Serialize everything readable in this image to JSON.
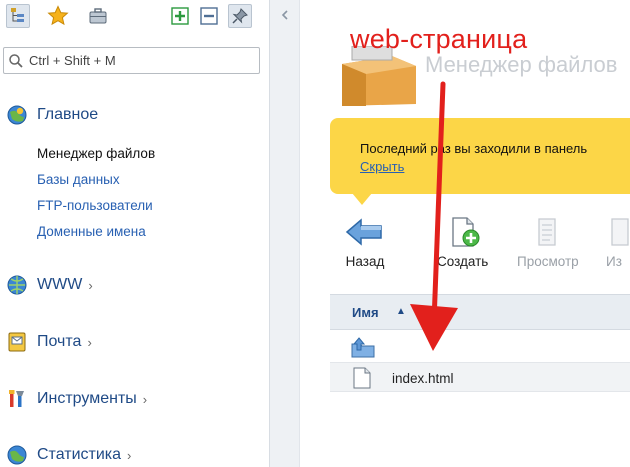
{
  "search": {
    "placeholder": "Ctrl + Shift + M"
  },
  "sidebar": {
    "main_section": {
      "label": "Главное",
      "items": [
        {
          "label": "Менеджер файлов",
          "active": true
        },
        {
          "label": "Базы данных"
        },
        {
          "label": "FTP-пользователи"
        },
        {
          "label": "Доменные имена"
        }
      ]
    },
    "sections": [
      {
        "label": "WWW",
        "chevron": "›"
      },
      {
        "label": "Почта",
        "chevron": "›"
      },
      {
        "label": "Инструменты",
        "chevron": "›"
      },
      {
        "label": "Статистика",
        "chevron": "›"
      }
    ]
  },
  "main": {
    "title": "Менеджер файлов",
    "notice": {
      "text": "Последний раз вы заходили в панель",
      "link": "Скрыть"
    },
    "actions": [
      {
        "label": "Назад",
        "icon": "back-arrow-icon"
      },
      {
        "label": "Создать",
        "icon": "new-document-icon"
      },
      {
        "label": "Просмотр",
        "icon": "view-icon"
      },
      {
        "label": "Из"
      }
    ],
    "grid": {
      "column": "Имя",
      "sort_indicator": "▲",
      "files": [
        {
          "name": "index.html"
        }
      ]
    }
  },
  "annotation": {
    "caption": "web-страница",
    "color": "#e2201c"
  },
  "colors": {
    "notice_bg": "#fcd647",
    "link": "#2860b2",
    "heading": "#1f4a86"
  }
}
